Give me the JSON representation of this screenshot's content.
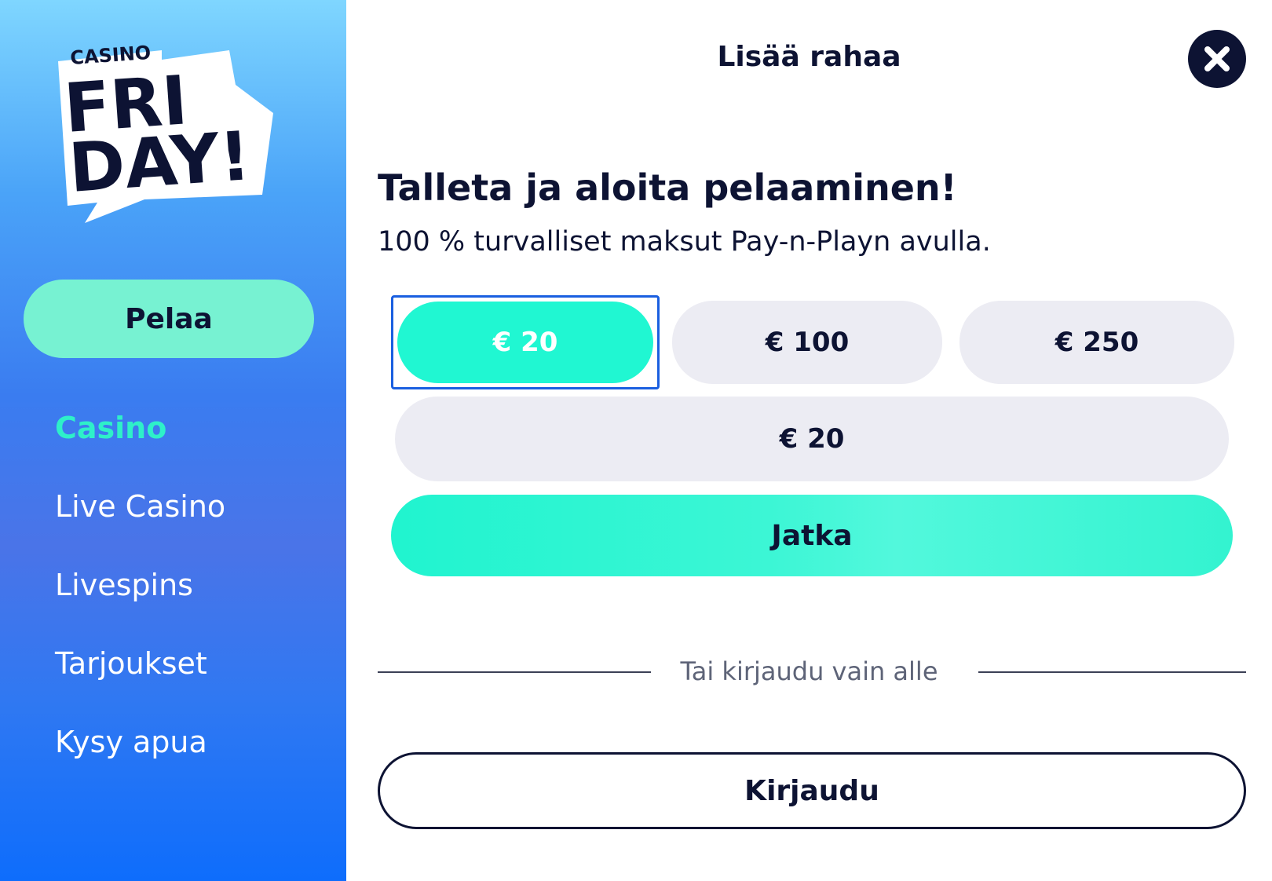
{
  "sidebar": {
    "logo": {
      "top_text": "CASINO",
      "line1": "FRI",
      "line2": "DAY!"
    },
    "play_button_label": "Pelaa",
    "nav_items": [
      {
        "label": "Casino",
        "active": true
      },
      {
        "label": "Live Casino",
        "active": false
      },
      {
        "label": "Livespins",
        "active": false
      },
      {
        "label": "Tarjoukset",
        "active": false
      },
      {
        "label": "Kysy apua",
        "active": false
      }
    ]
  },
  "modal": {
    "title": "Lisää rahaa",
    "close_icon": "close-icon",
    "heading": "Talleta ja aloita pelaaminen!",
    "subheading": "100 % turvalliset maksut Pay-n-Playn avulla.",
    "amount_options": [
      {
        "label": "€ 20",
        "selected": true
      },
      {
        "label": "€ 100",
        "selected": false
      },
      {
        "label": "€ 250",
        "selected": false
      }
    ],
    "amount_input_value": "€ 20",
    "continue_label": "Jatka",
    "divider_text": "Tai kirjaudu vain alle",
    "login_label": "Kirjaudu"
  },
  "colors": {
    "accent": "#20f7d2",
    "dark": "#0d1333",
    "selected_border": "#1a5fe0",
    "nav_active": "#2ef0c9"
  }
}
